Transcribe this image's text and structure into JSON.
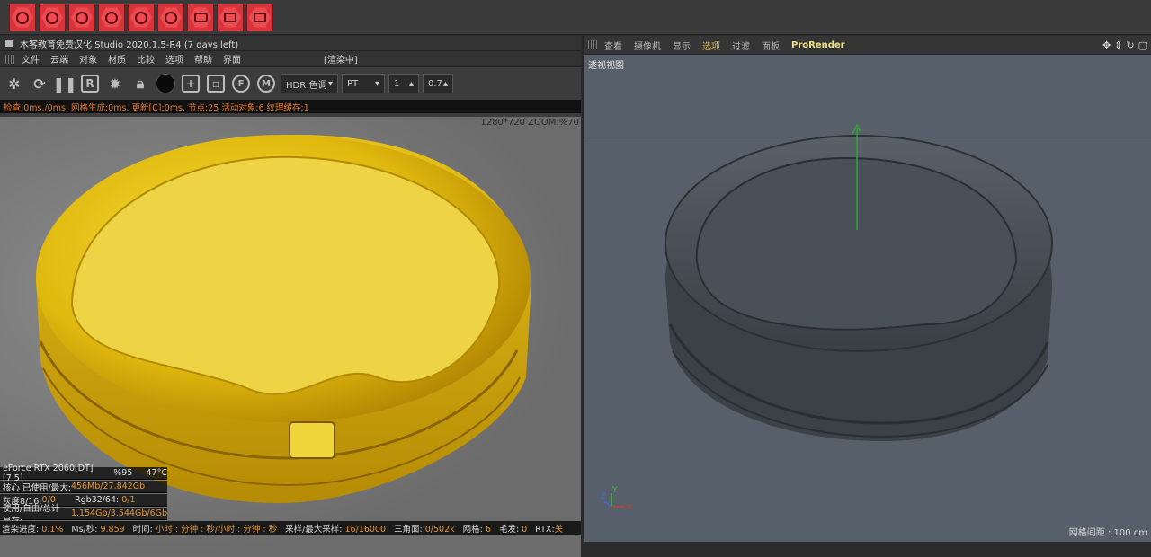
{
  "topbar": {
    "buttons": [
      {
        "name": "live-viewer-icon"
      },
      {
        "name": "render-settings-icon"
      },
      {
        "name": "light-icon"
      },
      {
        "name": "area-light-icon"
      },
      {
        "name": "material-icon"
      },
      {
        "name": "cloud-icon"
      },
      {
        "name": "camera-icon"
      },
      {
        "name": "monitor-icon"
      },
      {
        "name": "vr-icon"
      }
    ],
    "accent": "#d7343c"
  },
  "left": {
    "title": "木客教育免费汉化 Studio 2020.1.5-R4 (7 days left)",
    "menu": [
      "文件",
      "云端",
      "对象",
      "材质",
      "比较",
      "选项",
      "帮助",
      "界面"
    ],
    "rendering_label": "[渲染中]",
    "hdr_select": "HDR 色调",
    "mode_select": "PT",
    "spin1": "1",
    "spin2": "0.7",
    "status": "检查:0ms./0ms. 网格生成:0ms. 更新[C]:0ms. 节点:25 活动对象:6 纹理缓存:1",
    "resolution": "1280*720 ZOOM:%70",
    "gpu_line": {
      "name": "eForce RTX 2060[DT][7.5]",
      "usage": "%95",
      "temp": "47°C"
    },
    "core_line": {
      "label": "核心 已使用/最大:",
      "value": "456Mb/27.842Gb"
    },
    "gray_line": {
      "label": "灰度8/16:",
      "value": "0/0",
      "rgb_label": "Rgb32/64:",
      "rgb_value": "0/1"
    },
    "mem_line": {
      "label": "使用/自由/总计 显存:",
      "value": "1.154Gb/3.544Gb/6Gb"
    },
    "bottom": {
      "progress_label": "渲染进度:",
      "progress_value": "0.1%",
      "ms_label": "Ms/秒:",
      "ms_value": "9.859",
      "time_label": "时间:",
      "time_value": "小时 : 分钟 : 秒/小时 : 分钟 : 秒",
      "samples_label": "采样/最大采样:",
      "samples_value": "16/16000",
      "tri_label": "三角面:",
      "tri_value": "0/502k",
      "mesh_label": "网格:",
      "mesh_value": "6",
      "hair_label": "毛发:",
      "hair_value": "0",
      "rtx_label": "RTX:",
      "rtx_value": "关"
    }
  },
  "right": {
    "menu": [
      "查看",
      "摄像机",
      "显示",
      "选项",
      "过滤",
      "面板",
      "ProRender"
    ],
    "active_menu": "选项",
    "view_label": "透视视图",
    "grid_label": "网格间距 : 100 cm",
    "axis_labels": {
      "y": "Y",
      "z": "Z",
      "x": "X"
    }
  }
}
